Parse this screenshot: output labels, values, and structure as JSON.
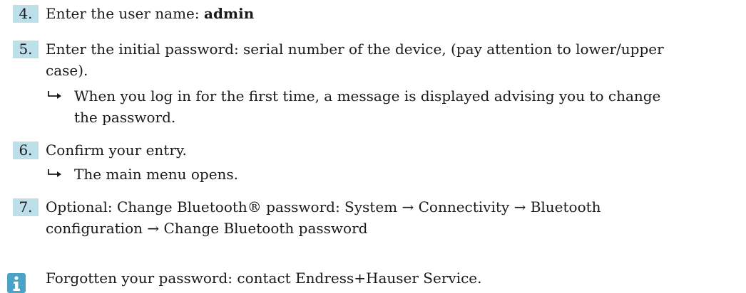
{
  "steps": [
    {
      "number": "4.",
      "text": "Enter the user name: ",
      "bold": "admin"
    },
    {
      "number": "5.",
      "line1": "Enter the initial password: serial number of the device, (pay attention to lower/upper",
      "line2": "case).",
      "result_line1": "When you log in for the first time, a message is displayed advising you to change",
      "result_line2": "the password."
    },
    {
      "number": "6.",
      "text": "Confirm your entry.",
      "result": "The main menu opens."
    },
    {
      "number": "7.",
      "line1": "Optional: Change Bluetooth® password: System → Connectivity → Bluetooth",
      "line2": "configuration → Change Bluetooth password"
    }
  ],
  "tip": {
    "icon": "info-tip-icon",
    "text": "Forgotten your password: contact Endress+Hauser Service."
  },
  "colors": {
    "number_highlight": "#bddfe9",
    "tip_icon": "#4aa3c7"
  }
}
